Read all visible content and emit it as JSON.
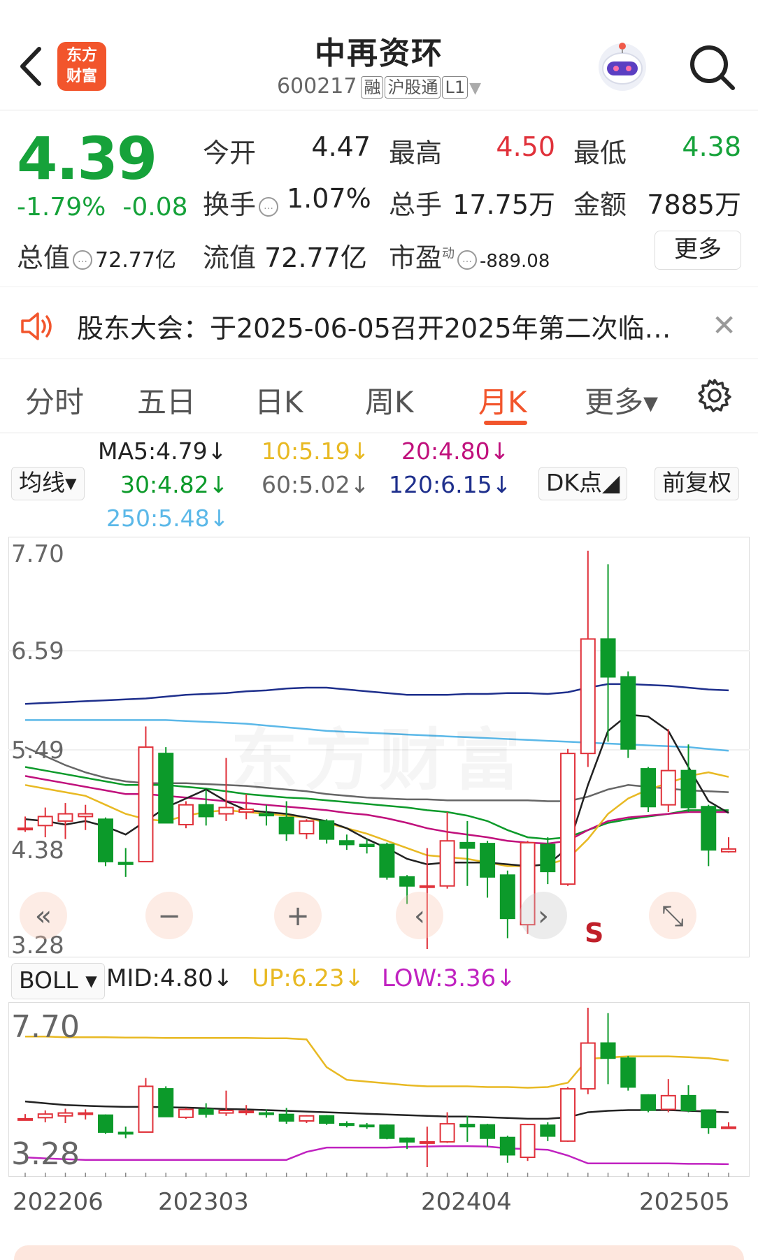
{
  "header": {
    "stock_name": "中再资环",
    "stock_code": "600217",
    "tags": [
      "融",
      "沪股通",
      "L1"
    ],
    "logo_lines": [
      "东方",
      "财富"
    ]
  },
  "quote": {
    "price": "4.39",
    "change_pct": "-1.79%",
    "change": "-0.08",
    "fields": {
      "open_label": "今开",
      "open": "4.47",
      "high_label": "最高",
      "high": "4.50",
      "low_label": "最低",
      "low": "4.38",
      "turnover_label": "换手",
      "turnover": "1.07%",
      "volume_label": "总手",
      "volume": "17.75万",
      "amount_label": "金额",
      "amount": "7885万",
      "mktcap_label": "总值",
      "mktcap": "72.77亿",
      "float_label": "流值",
      "float": "72.77亿",
      "pe_label": "市盈",
      "pe_sup": "动",
      "pe": "-889.08"
    },
    "more_label": "更多"
  },
  "notice": {
    "text": "股东大会：于2025-06-05召开2025年第二次临…",
    "close": "✕"
  },
  "tabs": [
    {
      "label": "分时"
    },
    {
      "label": "五日"
    },
    {
      "label": "日K"
    },
    {
      "label": "周K"
    },
    {
      "label": "月K",
      "active": true
    },
    {
      "label": "更多▾"
    }
  ],
  "ma": {
    "selector": "均线▾",
    "ma5": "MA5:4.79↓",
    "ma10": "10:5.19↓",
    "ma20": "20:4.80↓",
    "ma30": "30:4.82↓",
    "ma60": "60:5.02↓",
    "ma120": "120:6.15↓",
    "ma250": "250:5.48↓",
    "dk_btn": "DK点◢",
    "adjust_btn": "前复权",
    "colors": {
      "ma5": "#222222",
      "ma10": "#e8b923",
      "ma20": "#c0107c",
      "ma30": "#0c9a2a",
      "ma60": "#666666",
      "ma120": "#1e2f8c",
      "ma250": "#5bb8e8"
    }
  },
  "main_chart": {
    "y_labels": [
      "7.70",
      "6.59",
      "5.49",
      "4.38",
      "3.28"
    ],
    "signal_s": "S",
    "controls": [
      "«",
      "−",
      "+",
      "‹",
      "›",
      "⤡"
    ]
  },
  "boll": {
    "selector": "BOLL ▾",
    "mid": "MID:4.80↓",
    "up": "UP:6.23↓",
    "low": "LOW:3.36↓",
    "y_labels": [
      "7.70",
      "3.28"
    ]
  },
  "x_axis": [
    "202206",
    "202303",
    "202404",
    "202505"
  ],
  "chart_data": {
    "type": "candlestick",
    "ylim": [
      3.28,
      7.7
    ],
    "candles": [
      {
        "o": 4.62,
        "c": 4.62,
        "h": 4.75,
        "l": 4.58
      },
      {
        "o": 4.65,
        "c": 4.75,
        "h": 4.85,
        "l": 4.52
      },
      {
        "o": 4.7,
        "c": 4.78,
        "h": 4.9,
        "l": 4.5
      },
      {
        "o": 4.75,
        "c": 4.78,
        "h": 4.88,
        "l": 4.6
      },
      {
        "o": 4.72,
        "c": 4.25,
        "h": 4.74,
        "l": 4.2
      },
      {
        "o": 4.24,
        "c": 4.22,
        "h": 4.4,
        "l": 4.08
      },
      {
        "o": 4.25,
        "c": 5.52,
        "h": 5.75,
        "l": 4.25
      },
      {
        "o": 5.45,
        "c": 4.68,
        "h": 5.52,
        "l": 4.68
      },
      {
        "o": 4.66,
        "c": 4.88,
        "h": 4.92,
        "l": 4.62
      },
      {
        "o": 4.88,
        "c": 4.75,
        "h": 5.05,
        "l": 4.65
      },
      {
        "o": 4.78,
        "c": 4.85,
        "h": 5.4,
        "l": 4.7
      },
      {
        "o": 4.8,
        "c": 4.83,
        "h": 5.0,
        "l": 4.72
      },
      {
        "o": 4.78,
        "c": 4.76,
        "h": 4.88,
        "l": 4.65
      },
      {
        "o": 4.74,
        "c": 4.56,
        "h": 4.92,
        "l": 4.48
      },
      {
        "o": 4.56,
        "c": 4.7,
        "h": 4.72,
        "l": 4.5
      },
      {
        "o": 4.7,
        "c": 4.5,
        "h": 4.72,
        "l": 4.45
      },
      {
        "o": 4.48,
        "c": 4.44,
        "h": 4.55,
        "l": 4.38
      },
      {
        "o": 4.44,
        "c": 4.42,
        "h": 4.5,
        "l": 4.34
      },
      {
        "o": 4.44,
        "c": 4.08,
        "h": 4.46,
        "l": 4.05
      },
      {
        "o": 4.08,
        "c": 3.98,
        "h": 4.1,
        "l": 3.78
      },
      {
        "o": 3.98,
        "c": 3.98,
        "h": 4.4,
        "l": 3.28
      },
      {
        "o": 3.98,
        "c": 4.48,
        "h": 4.8,
        "l": 3.95
      },
      {
        "o": 4.46,
        "c": 4.4,
        "h": 4.7,
        "l": 3.98
      },
      {
        "o": 4.45,
        "c": 4.08,
        "h": 4.48,
        "l": 3.85
      },
      {
        "o": 4.1,
        "c": 3.62,
        "h": 4.15,
        "l": 3.4
      },
      {
        "o": 3.55,
        "c": 4.46,
        "h": 4.48,
        "l": 3.45
      },
      {
        "o": 4.44,
        "c": 4.14,
        "h": 4.52,
        "l": 4.0
      },
      {
        "o": 4.0,
        "c": 5.45,
        "h": 5.5,
        "l": 3.98
      },
      {
        "o": 5.45,
        "c": 6.72,
        "h": 7.7,
        "l": 5.3
      },
      {
        "o": 6.72,
        "c": 6.3,
        "h": 7.55,
        "l": 5.58
      },
      {
        "o": 6.3,
        "c": 5.5,
        "h": 6.36,
        "l": 5.4
      },
      {
        "o": 5.28,
        "c": 4.86,
        "h": 5.3,
        "l": 4.8
      },
      {
        "o": 4.88,
        "c": 5.26,
        "h": 5.72,
        "l": 4.8
      },
      {
        "o": 5.26,
        "c": 4.85,
        "h": 5.55,
        "l": 4.8
      },
      {
        "o": 4.86,
        "c": 4.38,
        "h": 4.88,
        "l": 4.2
      },
      {
        "o": 4.36,
        "c": 4.39,
        "h": 4.52,
        "l": 4.35
      }
    ],
    "series": [
      {
        "name": "MA120",
        "values": [
          6.0,
          6.01,
          6.02,
          6.03,
          6.04,
          6.05,
          6.06,
          6.08,
          6.1,
          6.11,
          6.12,
          6.14,
          6.15,
          6.17,
          6.18,
          6.18,
          6.16,
          6.14,
          6.12,
          6.1,
          6.1,
          6.1,
          6.11,
          6.11,
          6.12,
          6.12,
          6.11,
          6.13,
          6.18,
          6.22,
          6.22,
          6.21,
          6.2,
          6.18,
          6.16,
          6.15
        ]
      },
      {
        "name": "MA250",
        "values": [
          5.82,
          5.82,
          5.82,
          5.82,
          5.82,
          5.82,
          5.82,
          5.82,
          5.81,
          5.8,
          5.79,
          5.78,
          5.76,
          5.74,
          5.72,
          5.7,
          5.69,
          5.68,
          5.67,
          5.66,
          5.65,
          5.64,
          5.63,
          5.62,
          5.61,
          5.6,
          5.59,
          5.58,
          5.57,
          5.56,
          5.55,
          5.54,
          5.53,
          5.52,
          5.5,
          5.48
        ]
      },
      {
        "name": "MA60",
        "values": [
          5.52,
          5.42,
          5.32,
          5.24,
          5.18,
          5.14,
          5.12,
          5.12,
          5.12,
          5.11,
          5.1,
          5.09,
          5.07,
          5.05,
          5.03,
          5.0,
          4.98,
          4.96,
          4.95,
          4.94,
          4.94,
          4.93,
          4.93,
          4.93,
          4.93,
          4.93,
          4.92,
          4.92,
          4.97,
          5.05,
          5.1,
          5.08,
          5.06,
          5.04,
          5.03,
          5.02
        ]
      },
      {
        "name": "MA30",
        "values": [
          5.3,
          5.26,
          5.22,
          5.18,
          5.14,
          5.1,
          5.1,
          5.1,
          5.08,
          5.06,
          5.03,
          5.0,
          4.98,
          4.96,
          4.95,
          4.93,
          4.91,
          4.89,
          4.87,
          4.85,
          4.82,
          4.8,
          4.76,
          4.7,
          4.6,
          4.52,
          4.5,
          4.52,
          4.6,
          4.68,
          4.72,
          4.75,
          4.78,
          4.82,
          4.82,
          4.82
        ]
      },
      {
        "name": "MA20",
        "values": [
          5.2,
          5.16,
          5.12,
          5.08,
          5.04,
          5.0,
          5.0,
          4.98,
          4.96,
          4.94,
          4.92,
          4.9,
          4.88,
          4.86,
          4.84,
          4.82,
          4.79,
          4.77,
          4.73,
          4.68,
          4.62,
          4.58,
          4.55,
          4.52,
          4.48,
          4.46,
          4.45,
          4.48,
          4.6,
          4.7,
          4.74,
          4.76,
          4.78,
          4.8,
          4.8,
          4.8
        ]
      },
      {
        "name": "MA10",
        "values": [
          5.1,
          5.06,
          5.02,
          4.98,
          4.88,
          4.78,
          4.72,
          4.7,
          4.76,
          4.8,
          4.82,
          4.8,
          4.78,
          4.76,
          4.74,
          4.68,
          4.62,
          4.56,
          4.48,
          4.4,
          4.32,
          4.3,
          4.28,
          4.24,
          4.2,
          4.2,
          4.22,
          4.28,
          4.5,
          4.78,
          4.95,
          5.05,
          5.12,
          5.2,
          5.24,
          5.19
        ]
      },
      {
        "name": "MA5",
        "values": [
          4.72,
          4.7,
          4.66,
          4.7,
          4.64,
          4.55,
          4.7,
          4.85,
          4.95,
          5.05,
          4.92,
          4.82,
          4.8,
          4.78,
          4.74,
          4.7,
          4.62,
          4.5,
          4.4,
          4.28,
          4.22,
          4.24,
          4.24,
          4.24,
          4.22,
          4.2,
          4.22,
          4.4,
          5.1,
          5.7,
          5.88,
          5.86,
          5.7,
          5.3,
          4.92,
          4.79
        ]
      }
    ],
    "boll_ylim": [
      3.28,
      7.7
    ],
    "boll_series": [
      {
        "name": "UP",
        "values": [
          6.9,
          6.9,
          6.88,
          6.88,
          6.88,
          6.87,
          6.87,
          6.86,
          6.86,
          6.86,
          6.86,
          6.86,
          6.85,
          6.85,
          6.82,
          6.05,
          5.7,
          5.65,
          5.6,
          5.55,
          5.52,
          5.52,
          5.52,
          5.5,
          5.5,
          5.48,
          5.5,
          5.62,
          6.28,
          6.32,
          6.35,
          6.35,
          6.35,
          6.33,
          6.3,
          6.23
        ]
      },
      {
        "name": "MID",
        "values": [
          5.1,
          5.05,
          5.0,
          4.98,
          4.96,
          4.95,
          4.95,
          4.94,
          4.93,
          4.91,
          4.89,
          4.88,
          4.86,
          4.84,
          4.82,
          4.8,
          4.78,
          4.76,
          4.74,
          4.72,
          4.7,
          4.68,
          4.68,
          4.66,
          4.64,
          4.62,
          4.62,
          4.66,
          4.8,
          4.84,
          4.86,
          4.86,
          4.86,
          4.84,
          4.82,
          4.8
        ]
      },
      {
        "name": "LOW",
        "values": [
          3.55,
          3.52,
          3.5,
          3.48,
          3.48,
          3.48,
          3.48,
          3.48,
          3.48,
          3.48,
          3.48,
          3.48,
          3.48,
          3.48,
          3.7,
          3.82,
          3.82,
          3.82,
          3.82,
          3.84,
          3.85,
          3.86,
          3.86,
          3.85,
          3.8,
          3.78,
          3.76,
          3.6,
          3.38,
          3.38,
          3.38,
          3.38,
          3.38,
          3.37,
          3.37,
          3.36
        ]
      }
    ]
  }
}
